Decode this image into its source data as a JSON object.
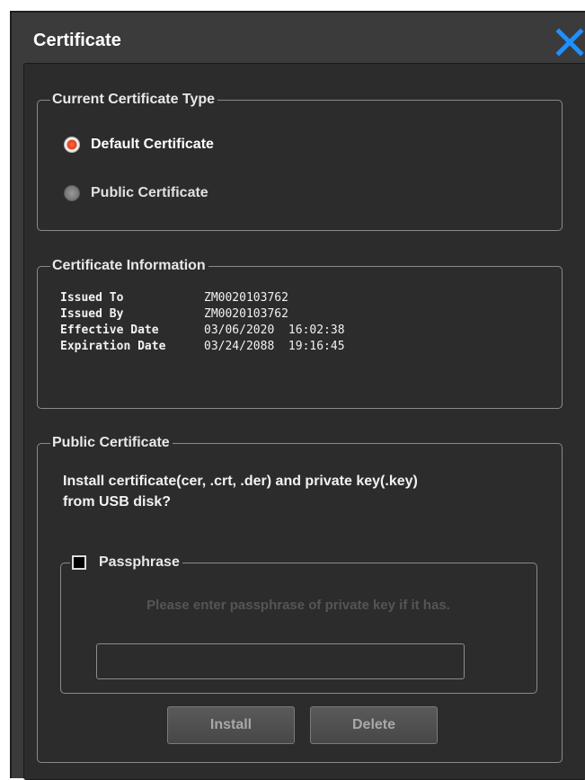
{
  "dialog": {
    "title": "Certificate"
  },
  "cert_type": {
    "legend": "Current Certificate Type",
    "options": [
      {
        "label": "Default Certificate",
        "selected": true
      },
      {
        "label": "Public Certificate",
        "selected": false
      }
    ]
  },
  "cert_info": {
    "legend": "Certificate Information",
    "rows": [
      {
        "key": "Issued To",
        "value": "ZM0020103762"
      },
      {
        "key": "Issued By",
        "value": "ZM0020103762"
      },
      {
        "key": "Effective Date",
        "value": "03/06/2020  16:02:38"
      },
      {
        "key": "Expiration Date",
        "value": "03/24/2088  19:16:45"
      }
    ]
  },
  "public_cert": {
    "legend": "Public Certificate",
    "question_line1": "Install certificate(cer, .crt, .der) and  private key(.key)",
    "question_line2": "from USB disk?",
    "passphrase": {
      "label": "Passphrase",
      "checked": false,
      "hint": "Please enter passphrase of private key if it has.",
      "value": ""
    },
    "install_label": "Install",
    "delete_label": "Delete"
  },
  "colors": {
    "accent": "#1e90ff",
    "radio_selected": "#e0401a",
    "panel": "#2c2c2c",
    "frame": "#3b3b3b"
  },
  "icons": {
    "close": "close-icon"
  }
}
